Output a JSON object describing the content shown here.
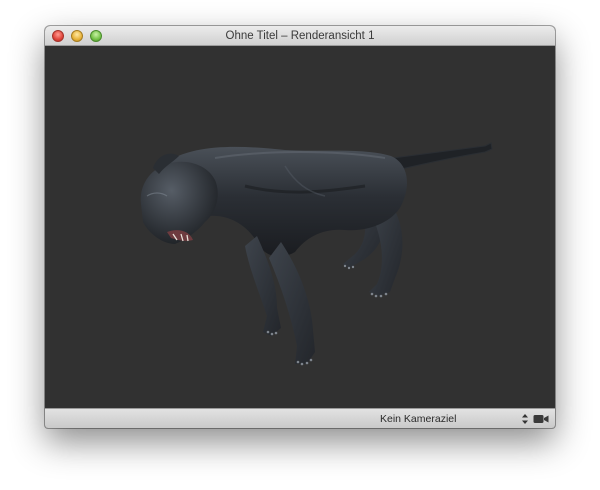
{
  "window": {
    "title": "Ohne Titel – Renderansicht 1",
    "controls": [
      "close-icon",
      "minimize-icon",
      "zoom-icon"
    ]
  },
  "viewport": {
    "background_color": "#313131",
    "subject": "panther-3d-model"
  },
  "statusbar": {
    "camera_target": "Kein Kameraziel",
    "icons": [
      "stepper-arrows-icon",
      "video-camera-icon"
    ]
  },
  "colors": {
    "close": "#e0443a",
    "minimize": "#e8b33a",
    "zoom": "#74c246"
  }
}
